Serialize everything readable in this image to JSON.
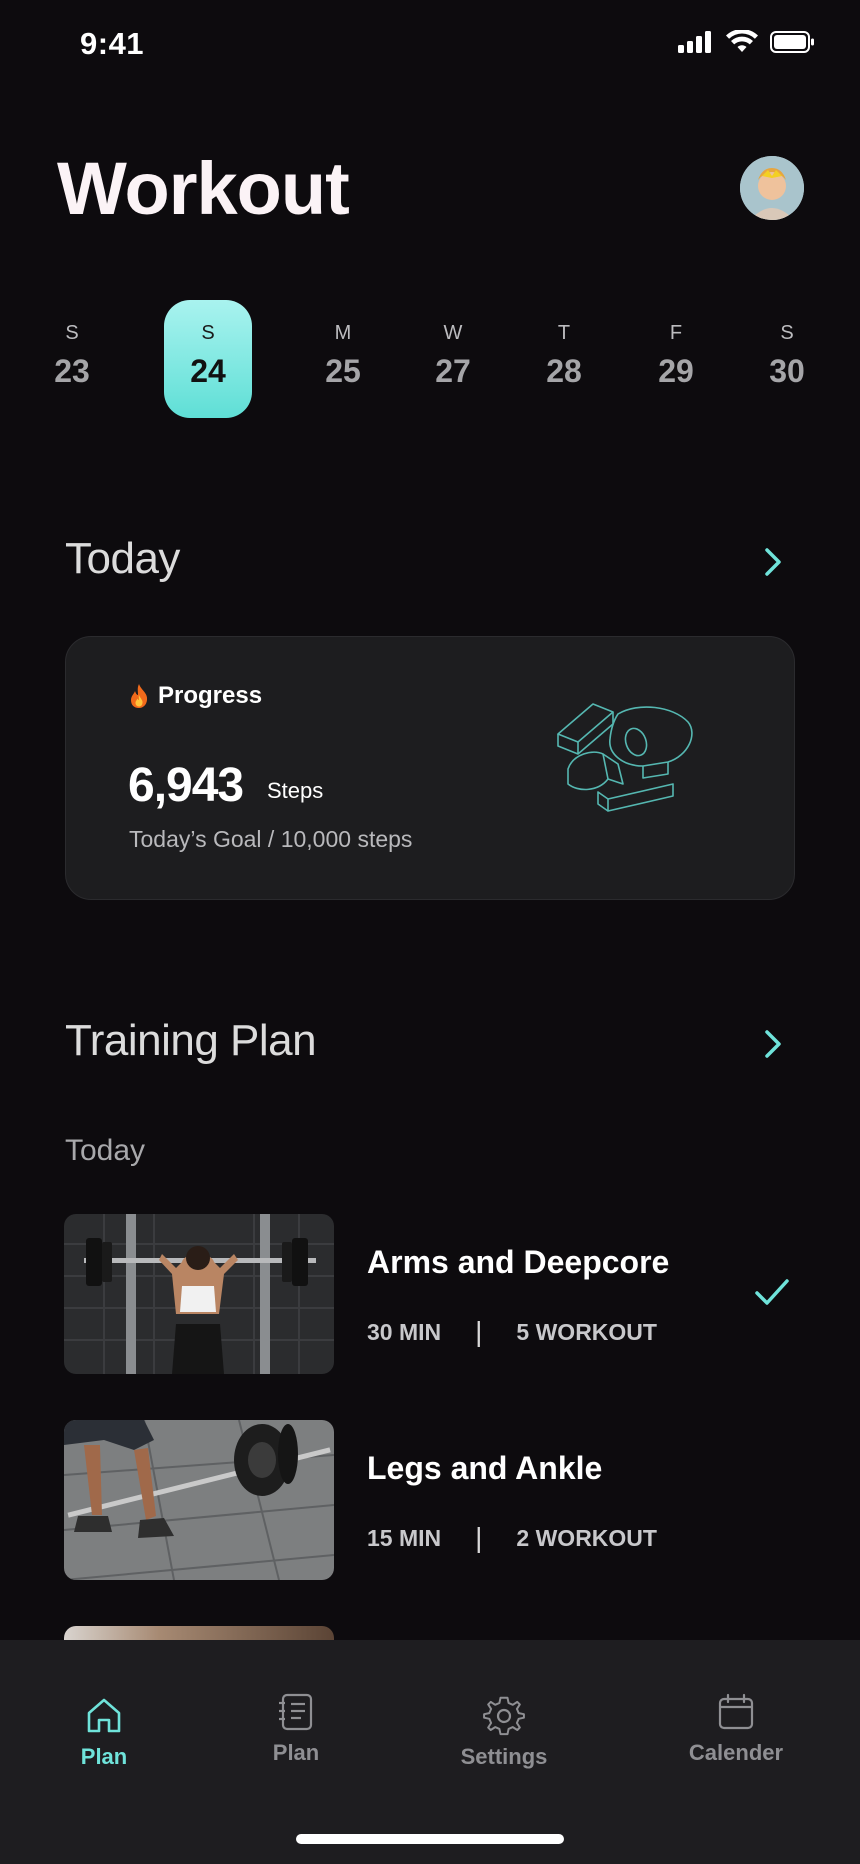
{
  "status_bar": {
    "time": "9:41"
  },
  "header": {
    "title": "Workout"
  },
  "calendar": {
    "days": [
      {
        "dow": "S",
        "num": "23",
        "selected": false
      },
      {
        "dow": "S",
        "num": "24",
        "selected": true
      },
      {
        "dow": "M",
        "num": "25",
        "selected": false
      },
      {
        "dow": "W",
        "num": "27",
        "selected": false
      },
      {
        "dow": "T",
        "num": "28",
        "selected": false
      },
      {
        "dow": "F",
        "num": "29",
        "selected": false
      },
      {
        "dow": "S",
        "num": "30",
        "selected": false
      }
    ]
  },
  "today_section": {
    "title": "Today"
  },
  "progress_card": {
    "label": "Progress",
    "icon": "fire-emoji",
    "steps_value": "6,943",
    "steps_unit": "Steps",
    "goal_text": "Today’s Goal / 10,000 steps"
  },
  "training_section": {
    "title": "Training Plan",
    "subheading": "Today",
    "items": [
      {
        "title": "Arms and Deepcore",
        "duration": "30 MIN",
        "count": "5 WORKOUT",
        "completed": true
      },
      {
        "title": "Legs and Ankle",
        "duration": "15 MIN",
        "count": "2 WORKOUT",
        "completed": false
      }
    ]
  },
  "tabbar": {
    "tabs": [
      {
        "label": "Plan",
        "icon": "home-icon",
        "active": true
      },
      {
        "label": "Plan",
        "icon": "notebook-icon",
        "active": false
      },
      {
        "label": "Settings",
        "icon": "gear-icon",
        "active": false
      },
      {
        "label": "Calender",
        "icon": "calendar-icon",
        "active": false
      }
    ]
  },
  "colors": {
    "background": "#0d0b0e",
    "accent": "#6fe3da",
    "card": "#1d1d1f",
    "tabbar": "#1e1d20"
  }
}
